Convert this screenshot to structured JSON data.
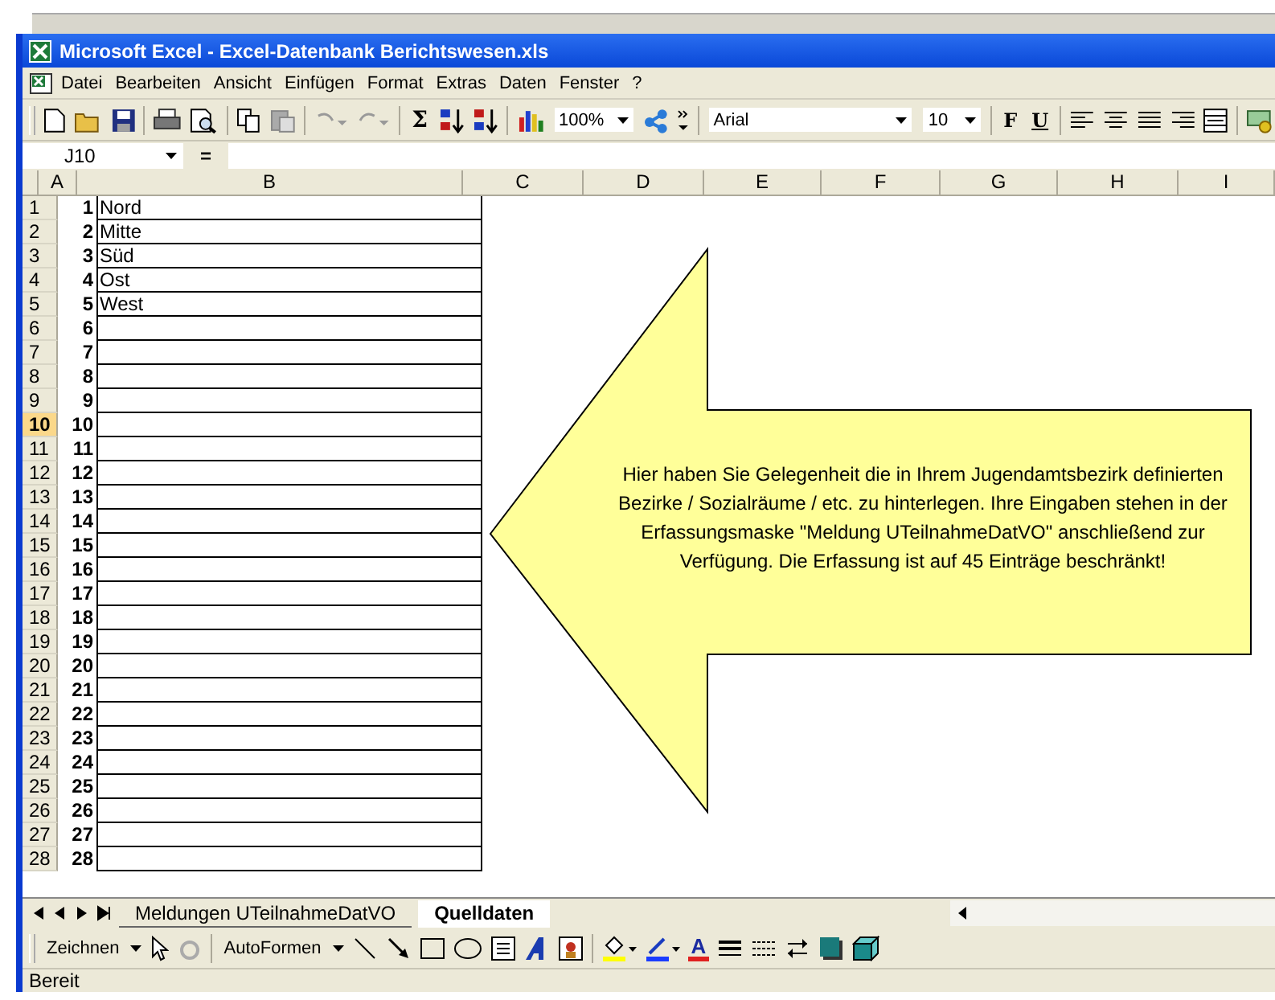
{
  "window": {
    "title": "Microsoft Excel - Excel-Datenbank Berichtswesen.xls"
  },
  "menu": [
    "Datei",
    "Bearbeiten",
    "Ansicht",
    "Einfügen",
    "Format",
    "Extras",
    "Daten",
    "Fenster",
    "?"
  ],
  "toolbar": {
    "sum_glyph": "Σ",
    "zoom": "100%",
    "font": "Arial",
    "size": "10",
    "bold_glyph": "F",
    "underline_glyph": "U"
  },
  "formula_bar": {
    "name_box": "J10",
    "equals": "="
  },
  "columns": [
    "A",
    "B",
    "C",
    "D",
    "E",
    "F",
    "G",
    "H",
    "I"
  ],
  "rows": [
    {
      "header": "1",
      "a": "1",
      "b": "Nord",
      "selected": false
    },
    {
      "header": "2",
      "a": "2",
      "b": "Mitte",
      "selected": false
    },
    {
      "header": "3",
      "a": "3",
      "b": "Süd",
      "selected": false
    },
    {
      "header": "4",
      "a": "4",
      "b": "Ost",
      "selected": false
    },
    {
      "header": "5",
      "a": "5",
      "b": "West",
      "selected": false
    },
    {
      "header": "6",
      "a": "6",
      "selected": false
    },
    {
      "header": "7",
      "a": "7",
      "selected": false
    },
    {
      "header": "8",
      "a": "8",
      "selected": false
    },
    {
      "header": "9",
      "a": "9",
      "selected": false
    },
    {
      "header": "10",
      "a": "10",
      "selected": true
    },
    {
      "header": "11",
      "a": "11",
      "selected": false
    },
    {
      "header": "12",
      "a": "12",
      "selected": false
    },
    {
      "header": "13",
      "a": "13",
      "selected": false
    },
    {
      "header": "14",
      "a": "14",
      "selected": false
    },
    {
      "header": "15",
      "a": "15",
      "selected": false
    },
    {
      "header": "16",
      "a": "16",
      "selected": false
    },
    {
      "header": "17",
      "a": "17",
      "selected": false
    },
    {
      "header": "18",
      "a": "18",
      "selected": false
    },
    {
      "header": "19",
      "a": "19",
      "selected": false
    },
    {
      "header": "20",
      "a": "20",
      "selected": false
    },
    {
      "header": "21",
      "a": "21",
      "selected": false
    },
    {
      "header": "22",
      "a": "22",
      "selected": false
    },
    {
      "header": "23",
      "a": "23",
      "selected": false
    },
    {
      "header": "24",
      "a": "24",
      "selected": false
    },
    {
      "header": "25",
      "a": "25",
      "selected": false
    },
    {
      "header": "26",
      "a": "26",
      "selected": false
    },
    {
      "header": "27",
      "a": "27",
      "selected": false
    },
    {
      "header": "28",
      "a": "28",
      "selected": false
    }
  ],
  "callout": {
    "text": "Hier haben Sie Gelegenheit die in Ihrem Jugendamtsbezirk definierten Bezirke / Sozialräume / etc. zu hinterlegen. Ihre Eingaben stehen in der Erfassungsmaske \"Meldung UTeilnahmeDatVO\" anschließend zur Verfügung. Die Erfassung ist auf 45 Einträge beschränkt!"
  },
  "sheet_tabs": [
    {
      "label": "Meldungen UTeilnahmeDatVO",
      "selected": false
    },
    {
      "label": "Quelldaten",
      "selected": true
    }
  ],
  "drawing_toolbar": {
    "draw_menu": "Zeichnen",
    "autoshapes_menu": "AutoFormen",
    "font_color_glyph": "A"
  },
  "status_bar": {
    "text": "Bereit"
  }
}
